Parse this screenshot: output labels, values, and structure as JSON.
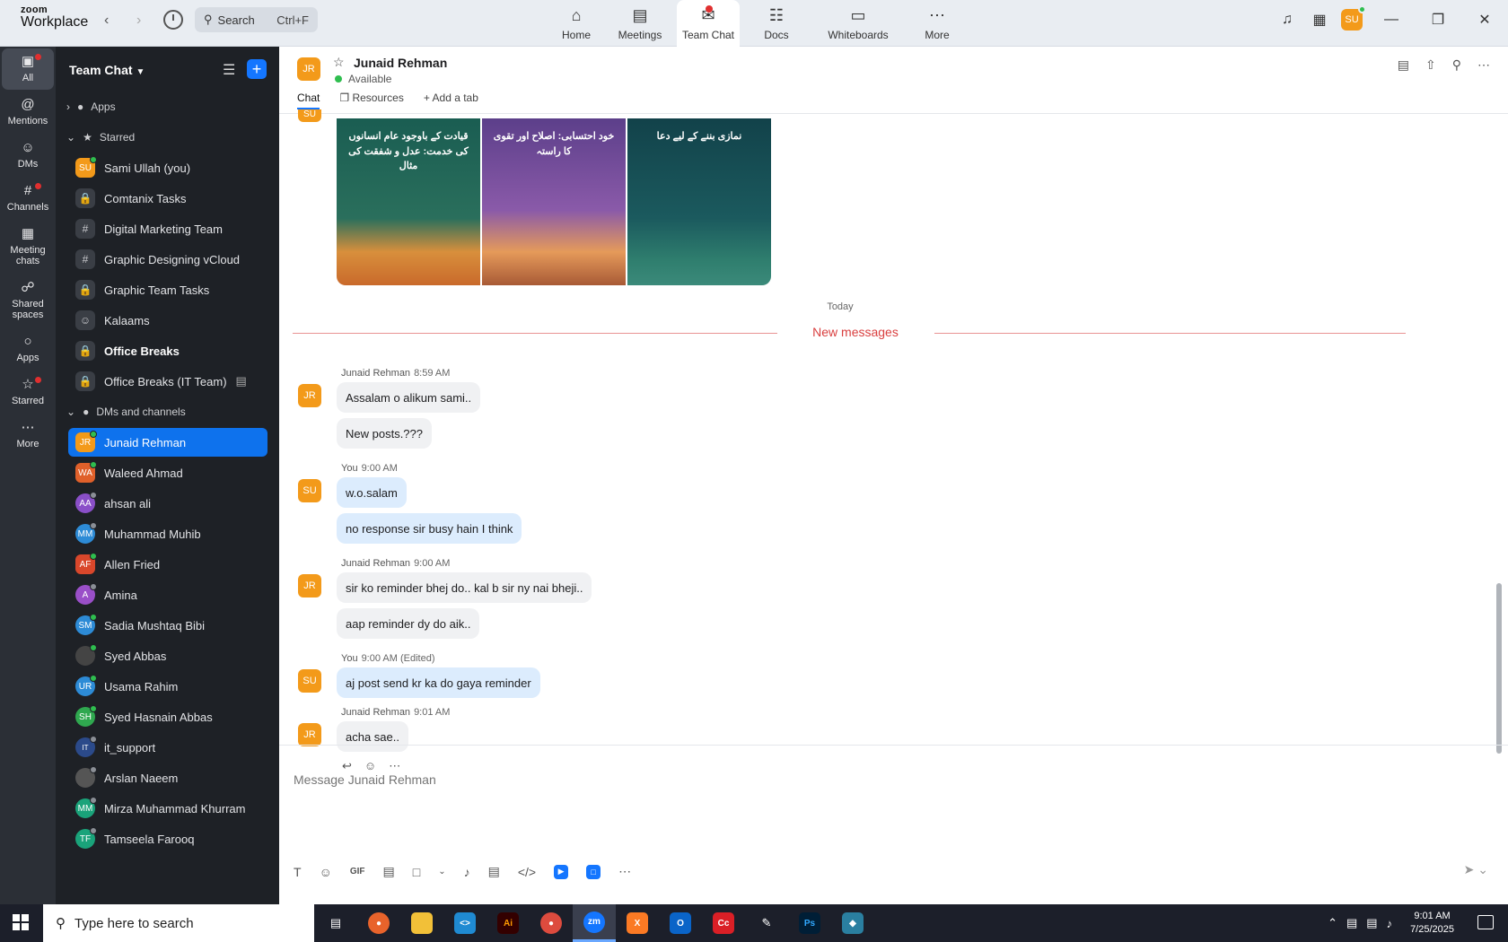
{
  "app": {
    "brand_top": "zoom",
    "brand_bottom": "Workplace"
  },
  "topbar": {
    "search_label": "Search",
    "search_shortcut": "Ctrl+F",
    "nav": [
      {
        "label": "Home",
        "icon": "home-icon"
      },
      {
        "label": "Meetings",
        "icon": "video-icon"
      },
      {
        "label": "Team Chat",
        "icon": "chat-icon"
      },
      {
        "label": "Docs",
        "icon": "doc-icon"
      },
      {
        "label": "Whiteboards",
        "icon": "whiteboard-icon"
      },
      {
        "label": "More",
        "icon": "more-icon"
      }
    ],
    "avatar": "SU"
  },
  "rail": [
    {
      "label": "All"
    },
    {
      "label": "Mentions"
    },
    {
      "label": "DMs"
    },
    {
      "label": "Channels"
    },
    {
      "label": "Meeting chats"
    },
    {
      "label": "Shared spaces"
    },
    {
      "label": "Apps"
    },
    {
      "label": "Starred"
    },
    {
      "label": "More"
    }
  ],
  "sidebar": {
    "title": "Team Chat",
    "apps_label": "Apps",
    "starred_label": "Starred",
    "dms_label": "DMs and channels",
    "starred": [
      {
        "name": "Sami Ullah (you)",
        "initials": "SU",
        "color": "#f39a1a"
      },
      {
        "name": "Comtanix Tasks"
      },
      {
        "name": "Digital Marketing Team"
      },
      {
        "name": "Graphic Designing vCloud"
      },
      {
        "name": "Graphic Team Tasks"
      },
      {
        "name": "Kalaams"
      },
      {
        "name": "Office Breaks"
      },
      {
        "name": "Office Breaks (IT Team)"
      }
    ],
    "dms": [
      {
        "name": "Junaid Rehman",
        "initials": "JR",
        "color": "#f39a1a"
      },
      {
        "name": "Waleed Ahmad",
        "initials": "WA",
        "color": "#e0602a"
      },
      {
        "name": "ahsan ali",
        "initials": "AA",
        "color": "#8a4fc8"
      },
      {
        "name": "Muhammad Muhib",
        "initials": "MM",
        "color": "#2d8bd6"
      },
      {
        "name": "Allen Fried",
        "initials": "AF",
        "color": "#d9472b"
      },
      {
        "name": "Amina",
        "initials": "A",
        "color": "#9a4fc8"
      },
      {
        "name": "Sadia Mushtaq Bibi",
        "initials": "SM",
        "color": "#2d8bd6"
      },
      {
        "name": "Syed Abbas",
        "initials": "",
        "color": "#444"
      },
      {
        "name": "Usama Rahim",
        "initials": "UR",
        "color": "#2d8bd6"
      },
      {
        "name": "Syed Hasnain Abbas",
        "initials": "SH",
        "color": "#2fa84f"
      },
      {
        "name": "it_support",
        "initials": "IT",
        "color": "#2b4a8a"
      },
      {
        "name": "Arslan Naeem",
        "initials": "",
        "color": "#555"
      },
      {
        "name": "Mirza Muhammad Khurram",
        "initials": "MM",
        "color": "#1aa37a"
      },
      {
        "name": "Tamseela Farooq",
        "initials": "TF",
        "color": "#1aa37a"
      }
    ]
  },
  "chat": {
    "contact_initials": "JR",
    "contact_name": "Junaid Rehman",
    "contact_status": "Available",
    "tabs": [
      "Chat",
      "Resources",
      "Add a tab"
    ],
    "images": [
      {
        "title": "قیادت کے باوجود عام انسانوں کی خدمت: عدل و شفقت کی مثال"
      },
      {
        "title": "خود احتسابی: اصلاح اور تقوی کا راستہ"
      },
      {
        "title": "نمازی بننے کے لیے دعا"
      }
    ],
    "today_label": "Today",
    "new_messages_label": "New messages",
    "messages": [
      {
        "initials": "JR",
        "sender": "Junaid Rehman",
        "time": "8:59 AM",
        "bubbles": [
          "Assalam o alikum sami..",
          "New posts.???"
        ],
        "dir": "in"
      },
      {
        "initials": "SU",
        "sender": "You",
        "time": "9:00 AM",
        "bubbles": [
          "w.o.salam",
          "no response sir busy hain I think"
        ],
        "dir": "out"
      },
      {
        "initials": "JR",
        "sender": "Junaid Rehman",
        "time": "9:00 AM",
        "bubbles": [
          "sir ko reminder bhej do.. kal b sir ny nai bheji..",
          "aap reminder dy do aik.."
        ],
        "dir": "in"
      },
      {
        "initials": "SU",
        "sender": "You",
        "time": "9:00 AM (Edited)",
        "bubbles": [
          "aj post send kr ka do gaya reminder"
        ],
        "dir": "out"
      },
      {
        "initials": "JR",
        "sender": "Junaid Rehman",
        "time": "9:01 AM",
        "bubbles": [
          "acha sae.."
        ],
        "dir": "in"
      }
    ],
    "composer_placeholder": "Message Junaid Rehman",
    "gif_label": "GIF"
  },
  "taskbar": {
    "search_placeholder": "Type here to search",
    "time": "9:01 AM",
    "date": "7/25/2025"
  }
}
